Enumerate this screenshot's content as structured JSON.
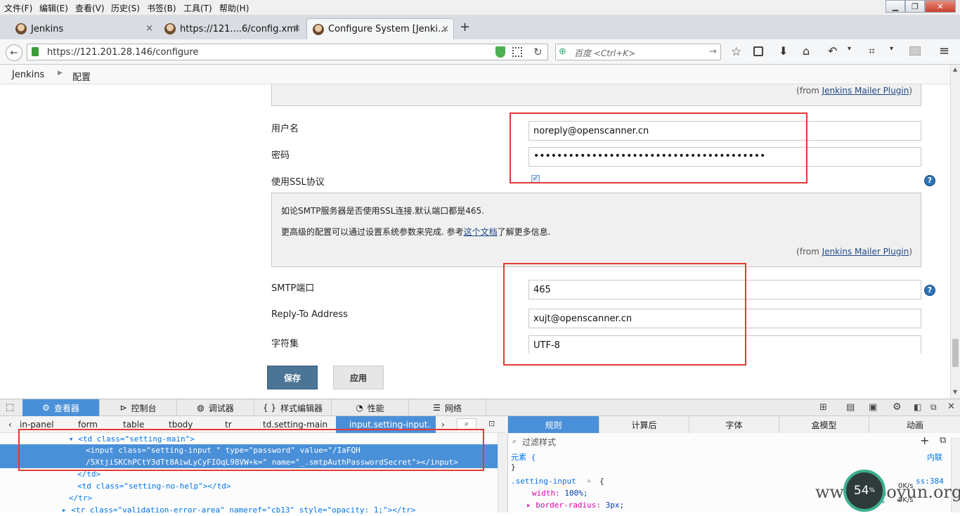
{
  "menubar": {
    "items": [
      "文件(F)",
      "编辑(E)",
      "查看(V)",
      "历史(S)",
      "书签(B)",
      "工具(T)",
      "帮助(H)"
    ]
  },
  "tabs": [
    {
      "title": "Jenkins",
      "close": "×"
    },
    {
      "title": "https://121....6/config.xml",
      "close": "×"
    },
    {
      "title": "Configure System [Jenki...",
      "close": "×"
    }
  ],
  "new_tab": "+",
  "navbar": {
    "url": "https://121.201.28.146/configure",
    "search_placeholder": "百度 <Ctrl+K>"
  },
  "breadcrumb": {
    "root": "Jenkins",
    "current": "配置"
  },
  "form": {
    "from_prefix": "(from ",
    "plugin_link": "Jenkins Mailer Plugin",
    "from_suffix": ")",
    "username_label": "用户名",
    "username_value": "noreply@openscanner.cn",
    "password_label": "密码",
    "password_value": "••••••••••••••••••••••••••••••••••••••••",
    "ssl_label": "使用SSL协议",
    "ssl_checked": true,
    "ssl_help_line1": "如论SMTP服务器是否使用SSL连接.默认端口都是465.",
    "ssl_help_line2_pre": "更高级的配置可以通过设置系统参数来完成. 参考",
    "ssl_help_link": "这个文档",
    "ssl_help_line2_post": "了解更多信息.",
    "smtp_port_label": "SMTP端口",
    "smtp_port_value": "465",
    "reply_to_label": "Reply-To Address",
    "reply_to_value": "xujt@openscanner.cn",
    "charset_label": "字符集",
    "charset_value": "UTF-8",
    "help_icon": "?",
    "save_label": "保存",
    "apply_label": "应用"
  },
  "devtools": {
    "tabs": [
      "查看器",
      "控制台",
      "调试器",
      "样式编辑器",
      "性能",
      "网络"
    ],
    "breadcrumbs": [
      "in-panel",
      "form",
      "table",
      "tbody",
      "tr",
      "td.setting-main",
      "input.setting-input."
    ],
    "html_lines": [
      "<td class=\"setting-main\">",
      "<input class=\"setting-input \" type=\"password\" value=\"/IaFQH",
      "/5XtjiSKChPCtY3dTt8AiwLyCyFIOqL98VW+k=\" name=\"_.smtpAuthPasswordSecret\"></input>",
      "</td>",
      "<td class=\"setting-no-help\"></td>",
      "</tr>",
      "<tr class=\"validation-error-area\" nameref=\"cb13\" style=\"opacity: 1;\"></tr>"
    ],
    "side_tabs": [
      "规则",
      "计算后",
      "字体",
      "盒模型",
      "动画"
    ],
    "filter_placeholder": "过滤样式",
    "element_rule": "元素 {",
    "element_close": "}",
    "inline_label": "内联",
    "selector": ".setting-input",
    "rule_brace": "{",
    "rule_source": "ss:384",
    "prop1_name": "width",
    "prop1_value": "100%;",
    "prop2_name": "border-radius",
    "prop2_value": "3px;"
  },
  "overlay": {
    "speed_value": "54",
    "speed_unit": "%",
    "up_rate": "0K/s",
    "down_rate": "0K/s",
    "watermark": "www.wooyun.org"
  },
  "colors": {
    "accent": "#4a90d9",
    "highlight": "#e53935",
    "save_button": "#4b7496",
    "help_bg": "#f0f0f0"
  }
}
